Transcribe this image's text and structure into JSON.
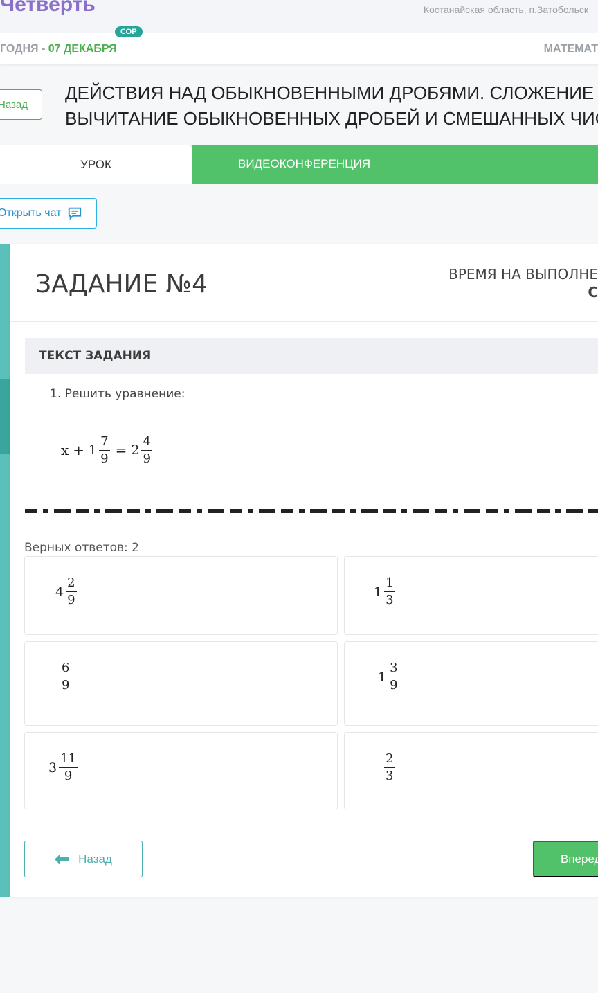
{
  "header": {
    "brand": "Четверть",
    "region": "Костанайская область, п.Затобольск"
  },
  "date_bar": {
    "prefix": "ГОДНЯ - ",
    "date": "07 ДЕКАБРЯ",
    "badge": "СОР",
    "subject": "МАТЕМАТ"
  },
  "lesson": {
    "back_label": "Назад",
    "title_line1": "ДЕЙСТВИЯ НАД ОБЫКНОВЕННЫМИ ДРОБЯМИ. СЛОЖЕНИЕ",
    "title_line2": "ВЫЧИТАНИЕ ОБЫКНОВЕННЫХ ДРОБЕЙ И СМЕШАННЫХ ЧИС"
  },
  "tabs": [
    {
      "label": "УРОК",
      "active": true
    },
    {
      "label": "ВИДЕОКОНФЕРЕНЦИЯ",
      "active": false
    }
  ],
  "chat": {
    "label": "Открыть чат",
    "icon": "chat-icon"
  },
  "task": {
    "number": "ЗАДАНИЕ №4",
    "time_label": "ВРЕМЯ НА ВЫПОЛНЕ",
    "time_value": "С",
    "text_heading": "ТЕКСТ ЗАДАНИЯ",
    "question": "1. Решить уравнение:",
    "equation": {
      "var": "x",
      "plus": "+",
      "a_whole": "1",
      "a_num": "7",
      "a_den": "9",
      "eq": "=",
      "b_whole": "2",
      "b_num": "4",
      "b_den": "9"
    },
    "correct_count": "Верных ответов: 2",
    "options": [
      {
        "whole": "4",
        "num": "2",
        "den": "9"
      },
      {
        "whole": "1",
        "num": "1",
        "den": "3"
      },
      {
        "whole": "",
        "num": "6",
        "den": "9"
      },
      {
        "whole": "1",
        "num": "3",
        "den": "9"
      },
      {
        "whole": "3",
        "num": "11",
        "den": "9"
      },
      {
        "whole": "",
        "num": "2",
        "den": "3"
      }
    ]
  },
  "nav": {
    "back_label": "Назад",
    "next_label": "Вперед"
  },
  "colors": {
    "green": "#52c26a",
    "teal": "#5bc0b9",
    "purple": "#8a70c8"
  }
}
